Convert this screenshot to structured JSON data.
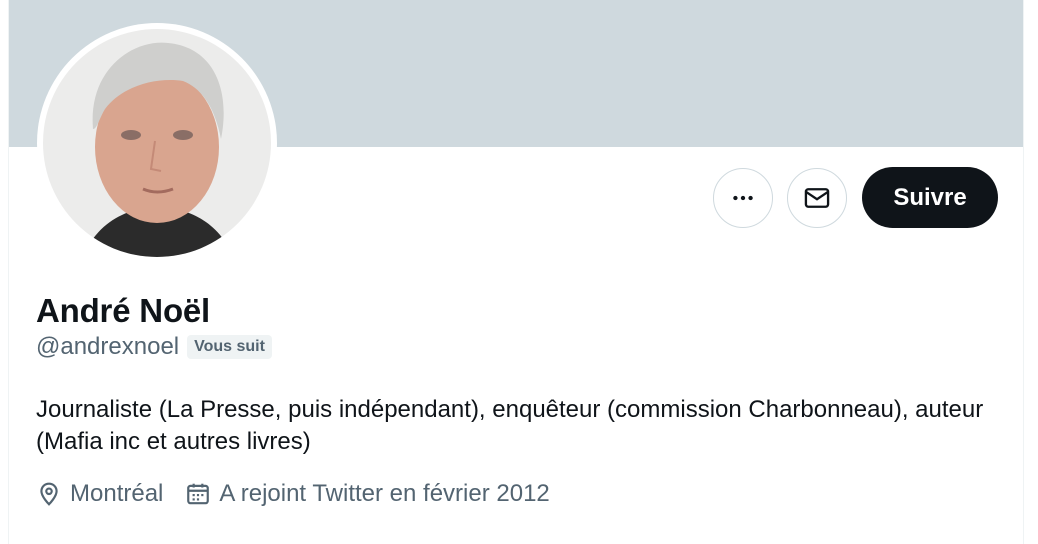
{
  "profile": {
    "display_name": "André Noël",
    "handle": "@andrexnoel",
    "follows_you_badge": "Vous suit",
    "bio": "Journaliste (La Presse, puis indépendant), enquêteur (commission Charbonneau), auteur (Mafia inc et autres livres)",
    "location": "Montréal",
    "joined": "A rejoint Twitter en février 2012"
  },
  "actions": {
    "more_icon": "more-dots-icon",
    "message_icon": "envelope-icon",
    "follow_label": "Suivre"
  },
  "stats": {
    "following_count": "",
    "following_label": "",
    "followers_count": "",
    "followers_label": ""
  },
  "colors": {
    "banner": "#cfd9de",
    "follow_button": "#0f1419",
    "secondary_text": "#536471"
  }
}
